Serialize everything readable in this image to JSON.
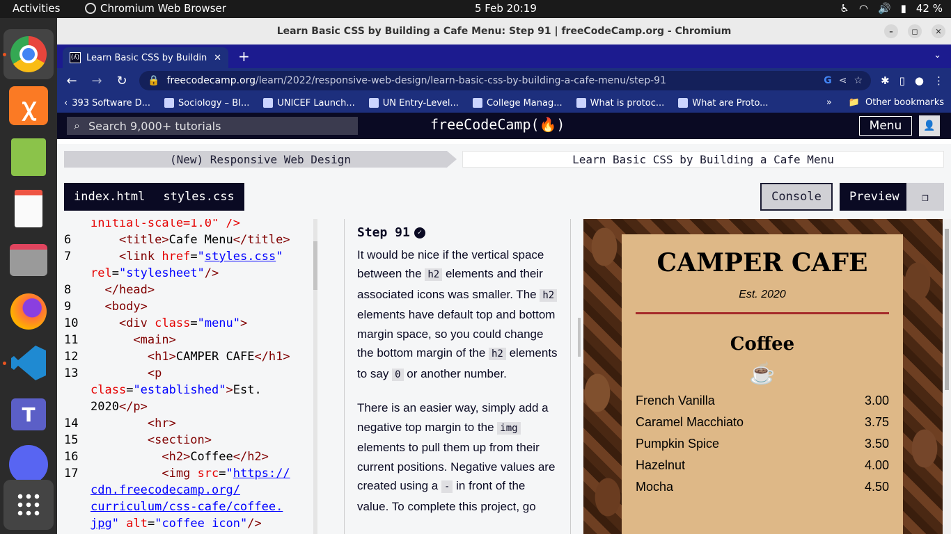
{
  "topbar": {
    "activities": "Activities",
    "app_name": "Chromium Web Browser",
    "clock": "5 Feb  20:19",
    "battery": "42 %"
  },
  "dock": {
    "apps": [
      "chromium-icon",
      "xampp-icon",
      "notepad-icon",
      "document-viewer-icon",
      "files-icon",
      "firefox-icon",
      "vscode-icon",
      "teams-icon",
      "discord-icon",
      "app-grid-icon"
    ]
  },
  "browser": {
    "window_title": "Learn Basic CSS by Building a Cafe Menu: Step 91 | freeCodeCamp.org - Chromium",
    "tab_title": "Learn Basic CSS by Buildin",
    "url_host": "freecodecamp.org",
    "url_path": "/learn/2022/responsive-web-design/learn-basic-css-by-building-a-cafe-menu/step-91",
    "bookmarks": [
      "393 Software D...",
      "Sociology – BI...",
      "UNICEF Launch...",
      "UN Entry-Level...",
      "College Manag...",
      "What is protoc...",
      "What are Proto..."
    ],
    "other_bookmarks": "Other bookmarks"
  },
  "fcc": {
    "search_placeholder": "Search 9,000+ tutorials",
    "logo": "freeCodeCamp(🔥)",
    "menu_label": "Menu",
    "breadcrumb_left": "(New) Responsive Web Design",
    "breadcrumb_right": "Learn Basic CSS by Building a Cafe Menu",
    "file_tabs": [
      "index.html",
      "styles.css"
    ],
    "console_label": "Console",
    "preview_label": "Preview"
  },
  "instructions": {
    "step": "Step 91",
    "p1_a": "It would be nice if the vertical space between the ",
    "p1_code1": "h2",
    "p1_b": " elements and their associated icons was smaller. The ",
    "p1_code2": "h2",
    "p1_c": " elements have default top and bottom margin space, so you could change the bottom margin of the ",
    "p1_code3": "h2",
    "p1_d": " elements to say ",
    "p1_code4": "0",
    "p1_e": " or another number.",
    "p2_a": "There is an easier way, simply add a negative top margin to the ",
    "p2_code1": "img",
    "p2_b": " elements to pull them up from their current positions. Negative values are created using a ",
    "p2_code2": "-",
    "p2_c": " in front of the value. To complete this project, go"
  },
  "preview": {
    "title": "CAMPER CAFE",
    "est": "Est. 2020",
    "section": "Coffee",
    "items": [
      {
        "name": "French Vanilla",
        "price": "3.00"
      },
      {
        "name": "Caramel Macchiato",
        "price": "3.75"
      },
      {
        "name": "Pumpkin Spice",
        "price": "3.50"
      },
      {
        "name": "Hazelnut",
        "price": "4.00"
      },
      {
        "name": "Mocha",
        "price": "4.50"
      }
    ]
  },
  "code": {
    "l0": "initial-scale=1.0\" />",
    "n6": "6",
    "n7": "7",
    "n8": "8",
    "n9": "9",
    "n10": "10",
    "n11": "11",
    "n12": "12",
    "n13": "13",
    "n14": "14",
    "n15": "15",
    "n16": "16",
    "n17": "17",
    "title_text": "Cafe Menu",
    "href_val": "styles.css",
    "h1_text": "CAMPER CAFE",
    "est_text": "Est.",
    "est_year": "2020",
    "h2_text": "Coffee",
    "img_url1": "https://",
    "img_url2": "cdn.freecodecamp.org/",
    "img_url3": "curriculum/css-cafe/coffee.",
    "img_url4": "jpg",
    "alt_val": "coffee icon"
  }
}
